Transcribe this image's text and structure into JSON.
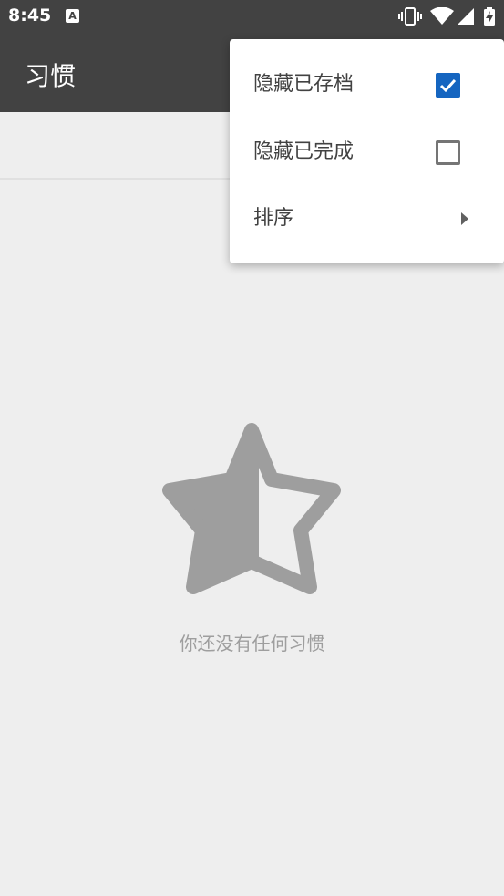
{
  "status_bar": {
    "time": "8:45",
    "notification_icon": "A",
    "icons": [
      "vibrate-icon",
      "wifi-icon",
      "signal-icon",
      "battery-charging-icon"
    ]
  },
  "toolbar": {
    "title": "习惯"
  },
  "empty_state": {
    "icon": "half-star-icon",
    "message": "你还没有任何习惯"
  },
  "menu": {
    "items": [
      {
        "label": "隐藏已存档",
        "checked": true
      },
      {
        "label": "隐藏已完成",
        "checked": false
      },
      {
        "label": "排序",
        "submenu": true
      }
    ]
  },
  "colors": {
    "bar_background": "#424242",
    "page_background": "#eeeeee",
    "accent": "#1565c0",
    "empty_icon": "#9e9e9e"
  }
}
